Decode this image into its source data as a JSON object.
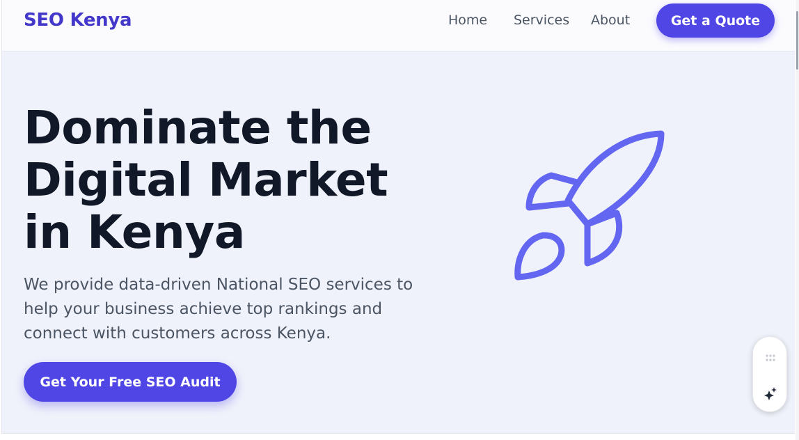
{
  "header": {
    "brand": "SEO Kenya",
    "nav": [
      "Home",
      "Services",
      "About"
    ],
    "cta_label": "Get a Quote"
  },
  "hero": {
    "title_lines": [
      "Dominate the",
      "Digital Market",
      "in Kenya"
    ],
    "description": "We provide data-driven National SEO services to help your business achieve top rankings and connect with customers across Kenya.",
    "cta_label": "Get Your Free SEO Audit",
    "illustration_icon": "rocket-icon"
  },
  "widget": {
    "icons": [
      "drag-handle-icon",
      "sparkle-icon"
    ]
  },
  "colors": {
    "accent": "#4f46e5",
    "brand": "#4338ca",
    "rocket": "#6366f1",
    "hero_background": "#f0f2fb",
    "heading": "#111827",
    "body_text": "#4b5563"
  }
}
